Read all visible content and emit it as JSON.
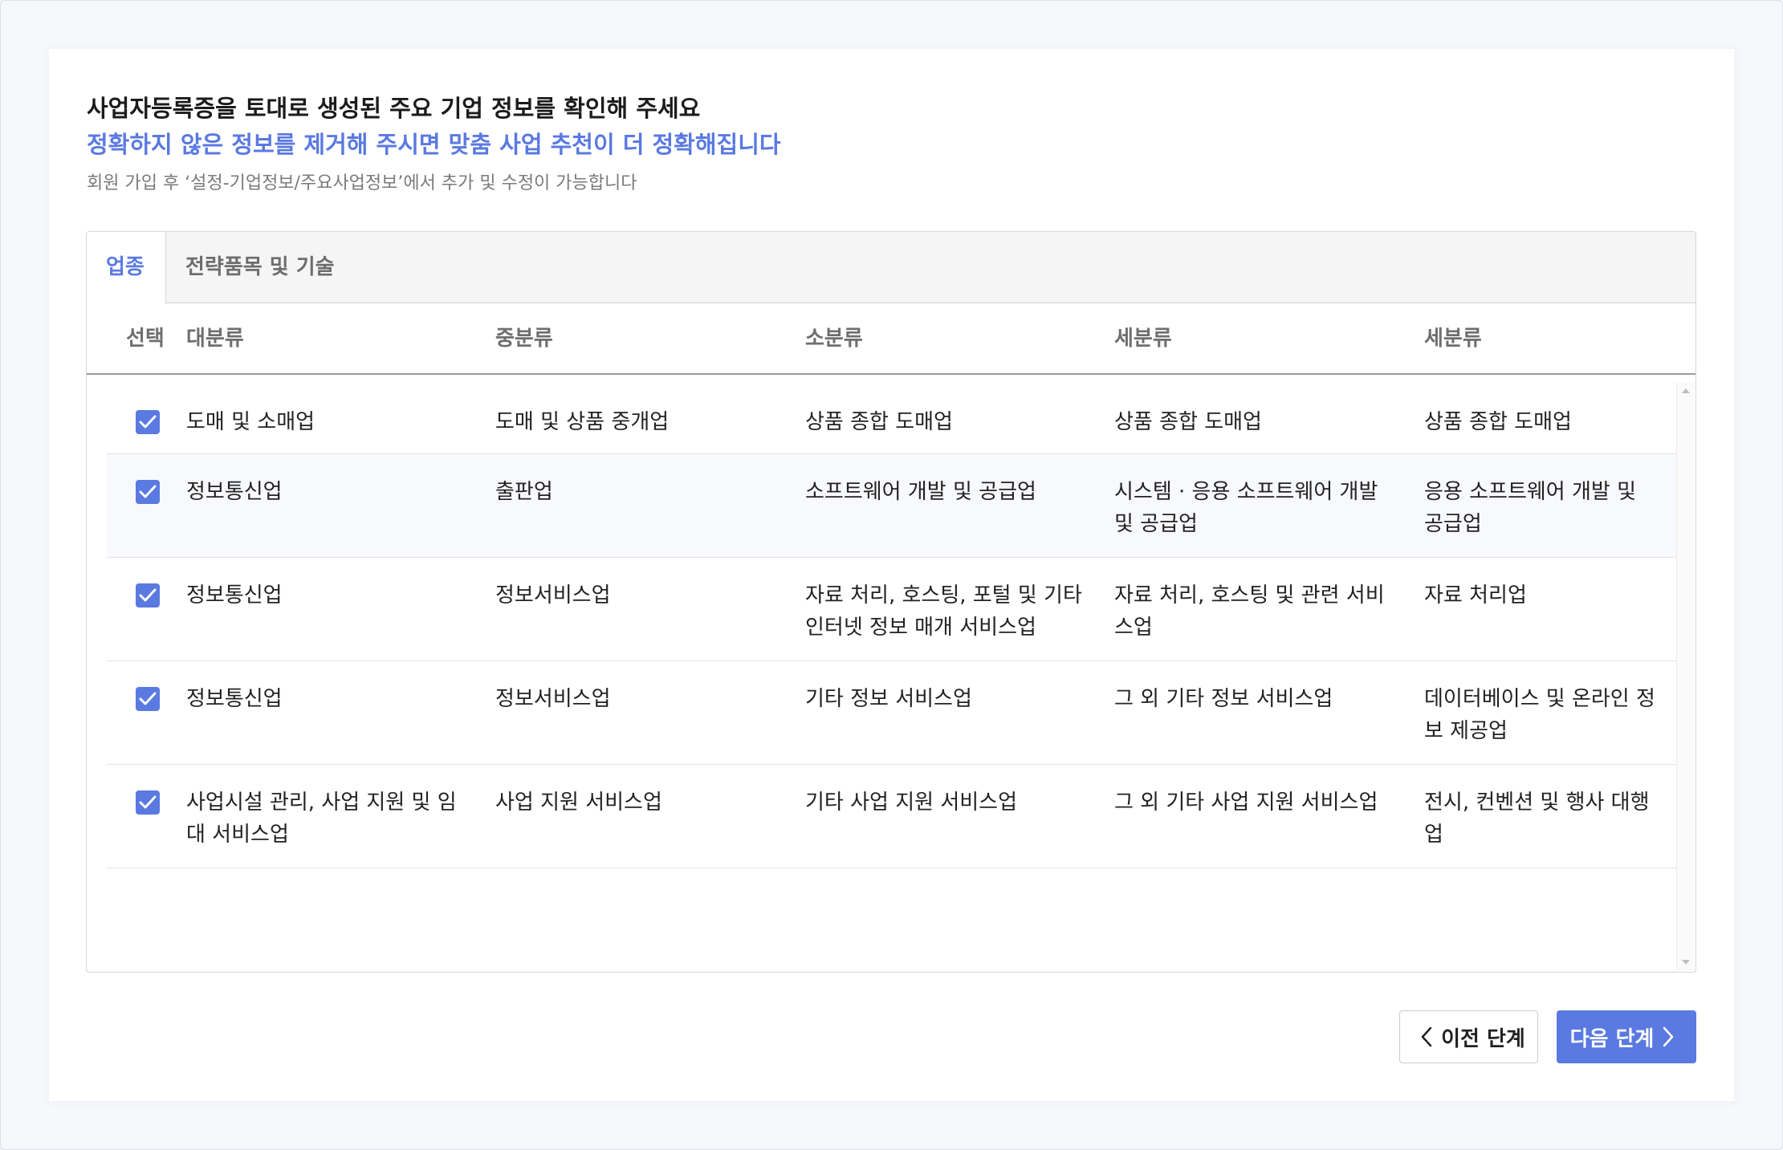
{
  "header": {
    "title": "사업자등록증을 토대로 생성된 주요 기업 정보를 확인해 주세요",
    "subtitle": "정확하지 않은 정보를 제거해 주시면 맞춤 사업 추천이 더 정확해집니다",
    "note": "회원 가입 후 ‘설정-기업정보/주요사업정보’에서 추가 및 수정이 가능합니다"
  },
  "tabs": [
    {
      "label": "업종",
      "active": true
    },
    {
      "label": "전략품목 및 기술",
      "active": false
    }
  ],
  "table": {
    "headers": [
      "선택",
      "대분류",
      "중분류",
      "소분류",
      "세분류",
      "세분류"
    ],
    "rows": [
      {
        "checked": true,
        "cells": [
          "도매 및 소매업",
          "도매 및 상품 중개업",
          "상품 종합 도매업",
          "상품 종합 도매업",
          "상품 종합 도매업"
        ]
      },
      {
        "checked": true,
        "cells": [
          "정보통신업",
          "출판업",
          "소프트웨어 개발 및 공급업",
          "시스템 · 응용 소프트웨어 개발 및 공급업",
          "응용 소프트웨어 개발 및 공급업"
        ]
      },
      {
        "checked": true,
        "cells": [
          "정보통신업",
          "정보서비스업",
          "자료 처리, 호스팅, 포털 및 기타 인터넷 정보 매개 서비스업",
          "자료 처리, 호스팅 및 관련 서비스업",
          "자료 처리업"
        ]
      },
      {
        "checked": true,
        "cells": [
          "정보통신업",
          "정보서비스업",
          "기타 정보 서비스업",
          "그 외 기타 정보 서비스업",
          "데이터베이스 및 온라인 정보 제공업"
        ]
      },
      {
        "checked": true,
        "cells": [
          "사업시설 관리, 사업 지원 및 임대 서비스업",
          "사업 지원 서비스업",
          "기타 사업 지원 서비스업",
          "그 외 기타 사업 지원 서비스업",
          "전시, 컨벤션 및 행사 대행업"
        ]
      }
    ]
  },
  "buttons": {
    "prev_label": "이전 단계",
    "next_label": "다음 단계"
  },
  "colors": {
    "accent": "#5a79e1",
    "border": "#d4d6dc",
    "text": "#222222",
    "muted": "#7a7a7a"
  },
  "icons": [
    "check-icon",
    "chevron-left-icon",
    "chevron-right-icon",
    "scroll-up-arrow-icon",
    "scroll-down-arrow-icon"
  ]
}
